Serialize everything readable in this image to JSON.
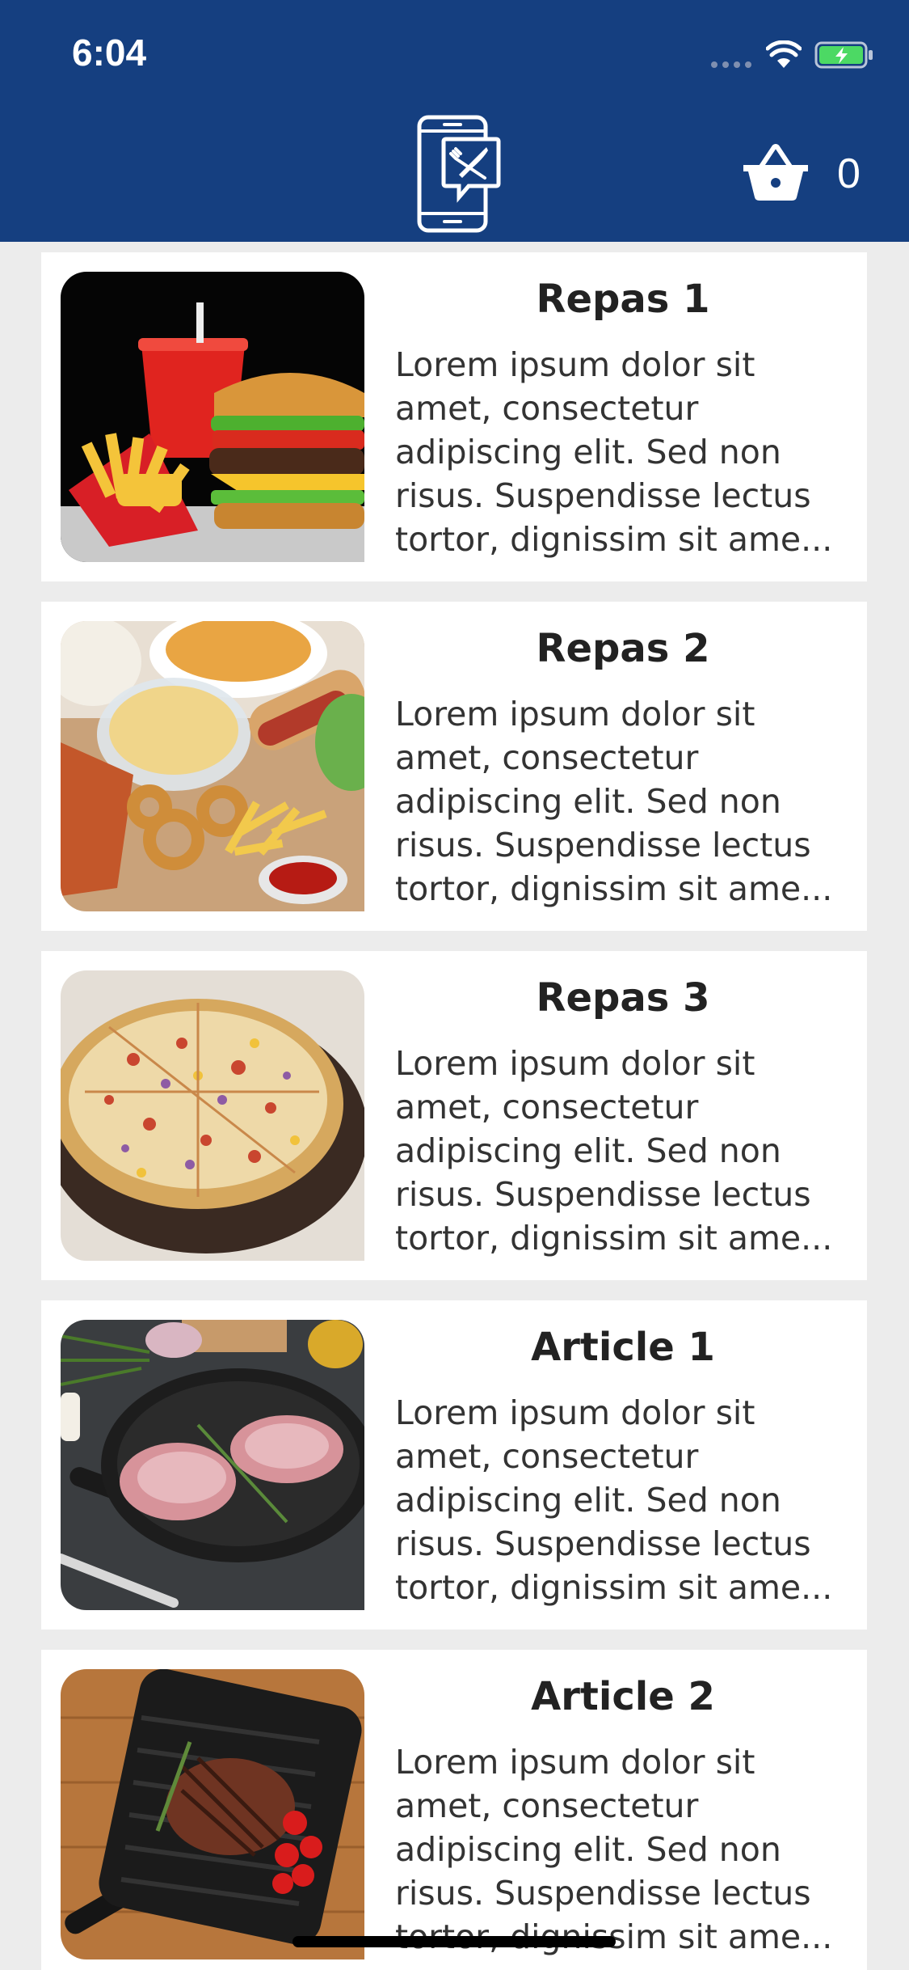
{
  "status_bar": {
    "time": "6:04",
    "wifi_icon": "wifi-icon",
    "battery_icon": "battery-charging-icon"
  },
  "header": {
    "background": "#153f80",
    "logo_icon": "phone-restaurant-icon",
    "cart_icon": "basket-icon",
    "cart_count": "0"
  },
  "items": [
    {
      "title": "Repas 1",
      "lines": [
        "Lorem ipsum dolor sit",
        "amet, consectetur",
        "adipiscing elit. Sed non",
        "risus. Suspendisse lectus",
        "tortor, dignissim sit ame..."
      ],
      "image": "burger-fries-photo"
    },
    {
      "title": "Repas 2",
      "lines": [
        "Lorem ipsum dolor sit",
        "amet, consectetur",
        "adipiscing elit. Sed non",
        "risus. Suspendisse lectus",
        "tortor, dignissim sit ame..."
      ],
      "image": "snacks-platter-photo"
    },
    {
      "title": "Repas 3",
      "lines": [
        "Lorem ipsum dolor sit",
        "amet, consectetur",
        "adipiscing elit. Sed non",
        "risus. Suspendisse lectus",
        "tortor, dignissim sit ame..."
      ],
      "image": "pizza-photo"
    },
    {
      "title": "Article 1",
      "lines": [
        "Lorem ipsum dolor sit",
        "amet, consectetur",
        "adipiscing elit. Sed non",
        "risus. Suspendisse lectus",
        "tortor, dignissim sit ame..."
      ],
      "image": "pan-meat-photo"
    },
    {
      "title": "Article 2",
      "lines": [
        "Lorem ipsum dolor sit",
        "amet, consectetur",
        "adipiscing elit. Sed non",
        "risus. Suspendisse lectus",
        "tortor, dignissim sit ame..."
      ],
      "image": "grill-steak-photo"
    }
  ]
}
